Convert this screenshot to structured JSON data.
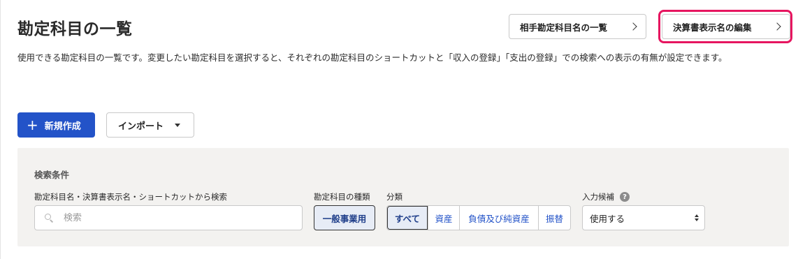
{
  "header": {
    "title": "勘定科目の一覧",
    "partner_button_label": "相手勘定科目名の一覧",
    "settlement_button_label": "決算書表示名の編集"
  },
  "description": "使用できる勘定科目の一覧です。変更したい勘定科目を選択すると、それぞれの勘定科目のショートカットと「収入の登録」「支出の登録」での検索への表示の有無が設定できます。",
  "actions": {
    "new_label": "新規作成",
    "import_label": "インポート"
  },
  "search": {
    "panel_title": "検索条件",
    "field_label": "勘定科目名・決算書表示名・ショートカットから検索",
    "placeholder": "検索",
    "value": ""
  },
  "kind": {
    "label": "勘定科目の種類",
    "selected": "一般事業用"
  },
  "classification": {
    "label": "分類",
    "options": [
      "すべて",
      "資産",
      "負債及び純資産",
      "振替"
    ],
    "selected": "すべて"
  },
  "input_candidate": {
    "label": "入力候補",
    "selected": "使用する"
  },
  "colors": {
    "primary": "#2353c8",
    "highlight": "#e6155f",
    "panel_bg": "#f3f2f0"
  }
}
